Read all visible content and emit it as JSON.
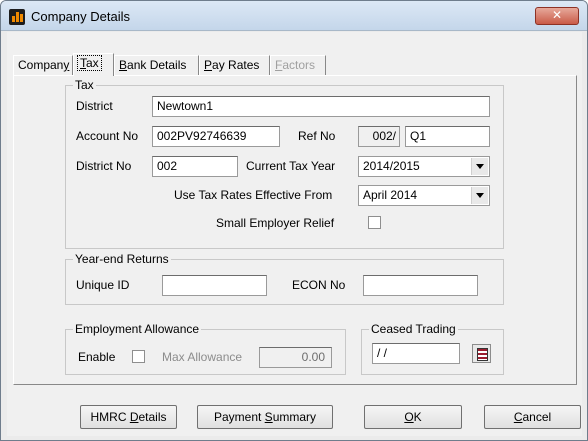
{
  "window": {
    "title": "Company Details",
    "close_glyph": "✕"
  },
  "tabs": [
    {
      "label": "Company",
      "underline": "y",
      "pre": "Compan",
      "post": ""
    },
    {
      "label": "Tax",
      "pre": "",
      "underline": "T",
      "post": "ax"
    },
    {
      "label": "Bank Details",
      "pre": "",
      "underline": "B",
      "post": "ank Details"
    },
    {
      "label": "Pay Rates",
      "pre": "",
      "underline": "P",
      "post": "ay Rates"
    },
    {
      "label": "Factors",
      "pre": "",
      "underline": "F",
      "post": "actors"
    }
  ],
  "tax": {
    "title": "Tax",
    "district_label": "District",
    "district_value": "Newtown1",
    "account_label": "Account No",
    "account_value": "002PV92746639",
    "ref_label": "Ref No",
    "ref_prefix": "002/",
    "ref_value": "Q1",
    "district_no_label": "District No",
    "district_no_value": "002",
    "current_year_label": "Current Tax Year",
    "current_year_value": "2014/2015",
    "effective_label": "Use Tax Rates Effective From",
    "effective_value": "April 2014",
    "relief_label": "Small Employer Relief"
  },
  "year_end": {
    "title": "Year-end Returns",
    "unique_label": "Unique ID",
    "unique_value": "",
    "econ_label": "ECON No",
    "econ_value": ""
  },
  "allowance": {
    "title": "Employment Allowance",
    "enable_label": "Enable",
    "max_label": "Max Allowance",
    "max_value": "0.00"
  },
  "ceased": {
    "title": "Ceased Trading",
    "date_value": " / /"
  },
  "buttons": {
    "hmrc": {
      "pre": "HMRC ",
      "u": "D",
      "post": "etails"
    },
    "payment": {
      "pre": "Payment ",
      "u": "S",
      "post": "ummary"
    },
    "ok": {
      "pre": "",
      "u": "O",
      "post": "K"
    },
    "cancel": {
      "pre": "",
      "u": "C",
      "post": "ancel"
    }
  }
}
